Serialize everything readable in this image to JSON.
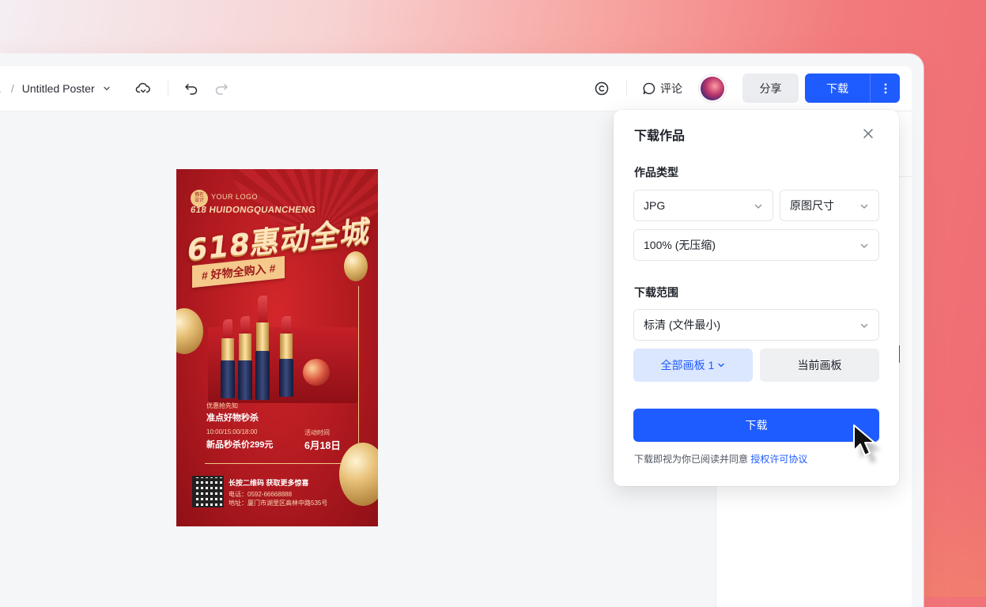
{
  "toolbar": {
    "ellipsis": ".",
    "separator": "/",
    "doc_title": "Untitled Poster",
    "comment_label": "评论",
    "share_label": "分享",
    "download_label": "下载"
  },
  "poster": {
    "logo_circle_text": "佛在\n设计",
    "logo_text": "YOUR LOGO",
    "subhead": "618 HUIDONGQUANCHENG",
    "headline": "618惠动全城",
    "tag": "# 好物全购入 #",
    "promo_small": "优惠抢先知",
    "promo_big": "准点好物秒杀",
    "time_small": "10:00/15:00/18:00",
    "price": "新品秒杀价299元",
    "date_small": "活动时间",
    "date": "6月18日",
    "qr_caption": "长按二维码 获取更多惊喜",
    "phone": "电话：0592-66668888",
    "address": "地址：厦门市湖里区高林中路535号"
  },
  "dialog": {
    "title": "下载作品",
    "type_label": "作品类型",
    "format_value": "JPG",
    "size_value": "原图尺寸",
    "quality_value": "100% (无压缩)",
    "range_label": "下载范围",
    "resolution_value": "标清 (文件最小)",
    "all_boards_label": "全部画板 1",
    "current_board_label": "当前画板",
    "confirm_label": "下载",
    "agree_text": "下载即视为你已阅读并同意 ",
    "agree_link": "授权许可协议"
  },
  "colors": {
    "primary": "#1f5cff",
    "poster_red": "#b11a20",
    "gold": "#f3c886"
  }
}
